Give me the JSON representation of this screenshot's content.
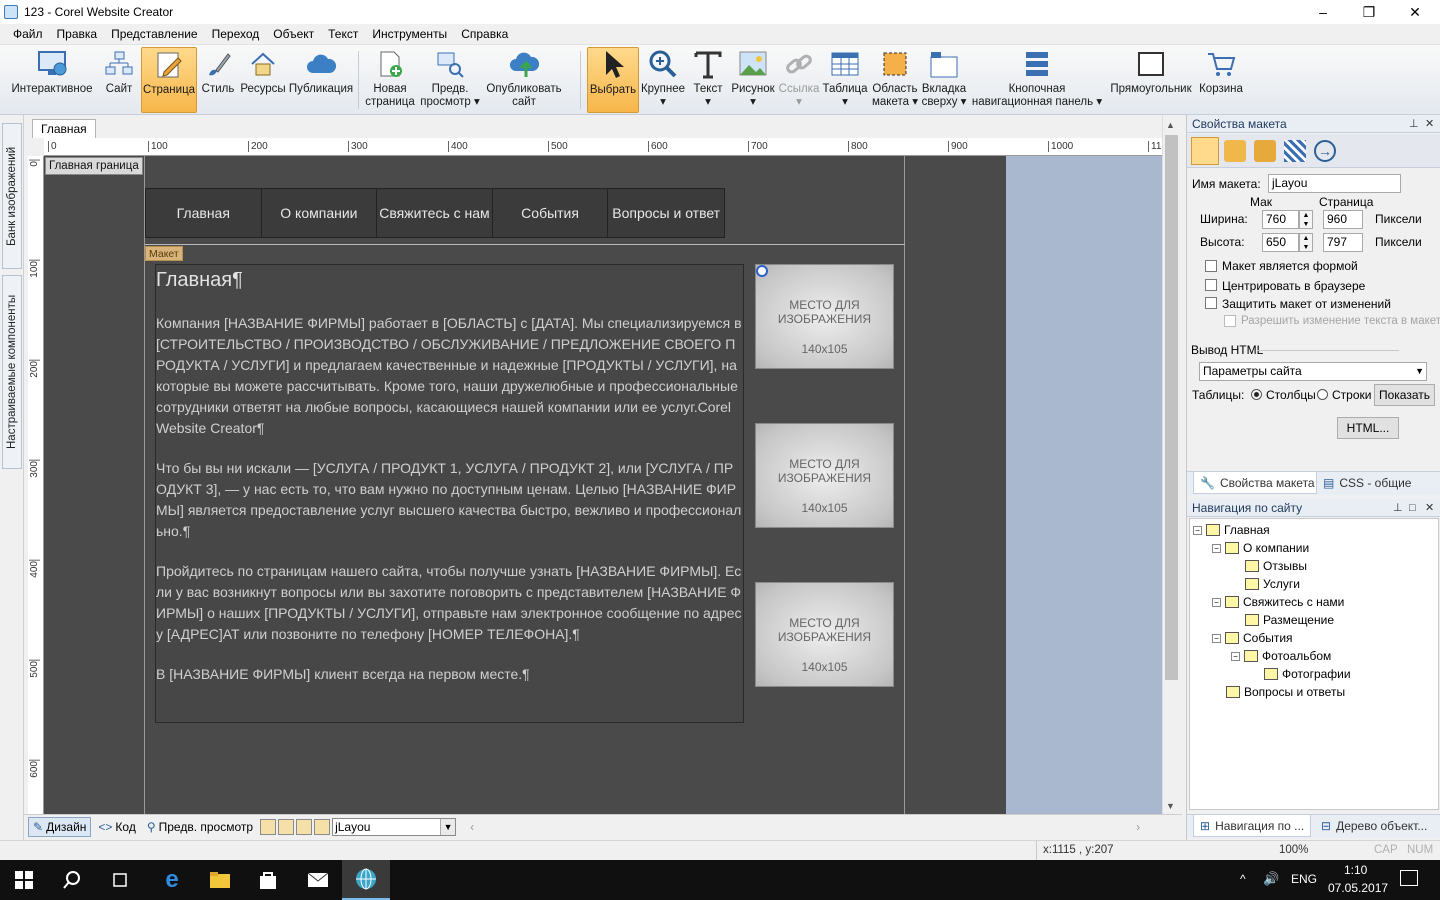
{
  "window": {
    "title": "123 - Corel Website Creator",
    "minimize": "–",
    "maximize": "❐",
    "close": "✕"
  },
  "menu": [
    "Файл",
    "Правка",
    "Представление",
    "Переход",
    "Объект",
    "Текст",
    "Инструменты",
    "Справка"
  ],
  "toolbar": {
    "interactive": "Интерактивное",
    "site": "Сайт",
    "page": "Страница",
    "style": "Стиль",
    "resources": "Ресурсы",
    "publication": "Публикация",
    "new_page": "Новая\nстраница",
    "preview": "Предв.\nпросмотр ▾",
    "publish_site": "Опубликовать\nсайт",
    "select": "Выбрать",
    "zoom": "Крупнее\n▾",
    "text": "Текст\n▾",
    "image": "Рисунок\n▾",
    "link": "Ссылка\n▾",
    "table": "Таблица\n▾",
    "layout_area": "Область\nмакета ▾",
    "top_tab": "Вкладка\nсверху ▾",
    "button_nav": "Кнопочная\nнавигационная панель ▾",
    "rectangle": "Прямоугольник",
    "cart": "Корзина"
  },
  "left_tabs": {
    "image_bank": "Банк изображений",
    "custom_components": "Настраиваемые компоненты"
  },
  "document": {
    "tab": "Главная",
    "page_label": "Главная граница",
    "maket_label": "Макет",
    "ruler_h": [
      "0",
      "100",
      "200",
      "300",
      "400",
      "500",
      "600",
      "700",
      "800",
      "900",
      "1000",
      "11"
    ],
    "ruler_v": [
      "0",
      "100",
      "200",
      "300",
      "400",
      "500",
      "600"
    ],
    "nav_buttons": [
      "Главная",
      "О компании",
      "Свяжитесь с нам",
      "События",
      "Вопросы и ответ"
    ],
    "heading": "Главная¶",
    "paragraphs": [
      "Компания [НАЗВАНИЕ ФИРМЫ] работает в [ОБЛАСТЬ] с [ДАТА]. Мы специализируемся в [СТРОИТЕЛЬСТВО / ПРОИЗВОДСТВО / ОБСЛУЖИВАНИЕ / ПРЕДЛОЖЕНИЕ СВОЕГО ПРОДУКТА / УСЛУГИ] и предлагаем качественные и надежные [ПРОДУКТЫ / УСЛУГИ], на которые вы можете рассчитывать. Кроме того, наши дружелюбные и профессиональные сотрудники ответят на любые вопросы, касающиеся нашей компании или ее услуг.Corel Website Creator¶",
      "Что бы вы ни искали — [УСЛУГА / ПРОДУКТ 1, УСЛУГА / ПРОДУКТ 2], или [УСЛУГА / ПРОДУКТ 3], — у нас есть то, что вам нужно по доступным ценам. Целью [НАЗВАНИЕ ФИРМЫ] является предоставление услуг высшего качества быстро, вежливо и профессионально.¶",
      "Пройдитесь по страницам нашего сайта, чтобы получше узнать [НАЗВАНИЕ ФИРМЫ]. Если у вас возникнут вопросы или вы захотите поговорить с представителем [НАЗВАНИЕ ФИРМЫ] о наших [ПРОДУКТЫ / УСЛУГИ], отправьте нам электронное сообщение по адресу [АДРЕС]АТ или позвоните по телефону [НОМЕР ТЕЛЕФОНА].¶",
      "В [НАЗВАНИЕ ФИРМЫ] клиент всегда на первом месте.¶"
    ],
    "placeholder_text": "МЕСТО ДЛЯ\nИЗОБРАЖЕНИЯ",
    "placeholder_size": "140x105"
  },
  "docbar": {
    "design": "Дизайн",
    "code": "Код",
    "preview": "Предв. просмотр",
    "layout_select": "jLayou"
  },
  "status": {
    "coords": "x:1115 , y:207",
    "zoom": "100%",
    "cap": "CAP",
    "num": "NUM"
  },
  "layout_props": {
    "header": "Свойства макета",
    "name_label": "Имя макета:",
    "name_value": "jLayou",
    "col_max": "Мак",
    "col_page": "Страница",
    "width_label": "Ширина:",
    "width_max": "760",
    "width_page": "960",
    "height_label": "Высота:",
    "height_max": "650",
    "height_page": "797",
    "units": "Пиксели",
    "cb_form": "Макет является формой",
    "cb_center": "Центрировать в браузере",
    "cb_protect": "Защитить макет от изменений",
    "cb_allow_text": "Разрешить изменение текста в макете",
    "html_output_label": "Вывод HTML",
    "html_output_value": "Параметры сайта",
    "tables_label": "Таблицы:",
    "radio_cols": "Столбцы",
    "radio_rows": "Строки",
    "show_btn": "Показать",
    "html_btn": "HTML...",
    "tab1": "Свойства макета",
    "tab2": "CSS - общие"
  },
  "site_nav": {
    "header": "Навигация по сайту",
    "items": [
      {
        "label": "Главная",
        "level": 0
      },
      {
        "label": "О компании",
        "level": 1
      },
      {
        "label": "Отзывы",
        "level": 2
      },
      {
        "label": "Услуги",
        "level": 2
      },
      {
        "label": "Свяжитесь с нами",
        "level": 1
      },
      {
        "label": "Размещение",
        "level": 2
      },
      {
        "label": "События",
        "level": 1
      },
      {
        "label": "Фотоальбом",
        "level": 2
      },
      {
        "label": "Фотографии",
        "level": 3
      },
      {
        "label": "Вопросы и ответы",
        "level": 1
      }
    ],
    "tab1": "Навигация по ...",
    "tab2": "Дерево объект..."
  },
  "taskbar": {
    "lang": "ENG",
    "time": "1:10",
    "date": "07.05.2017"
  },
  "colors": {
    "accent": "#f7b64a",
    "canvas": "#4b4b4b",
    "blue_area": "#a9b7cf"
  }
}
